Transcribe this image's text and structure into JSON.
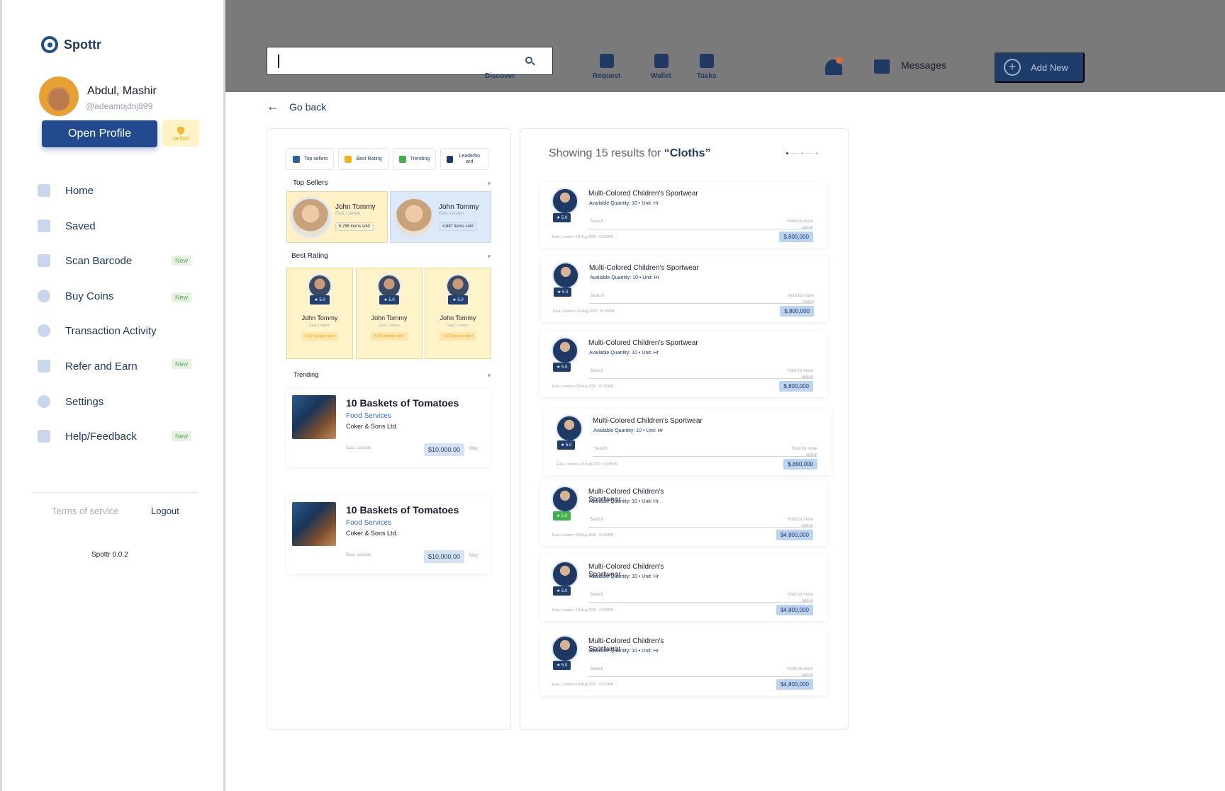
{
  "app": {
    "name": "Spottr",
    "version": "Spottr  0.0.2"
  },
  "user": {
    "name": "Abdul, Mashir",
    "handle": "@adeamojdnj899",
    "open_profile": "Open Profile",
    "verified": "Verified"
  },
  "sidebar": {
    "items": [
      {
        "label": "Home",
        "icon": "home-grid-icon",
        "badge": ""
      },
      {
        "label": "Saved",
        "icon": "bookmark-icon",
        "badge": ""
      },
      {
        "label": "Scan Barcode",
        "icon": "barcode-icon",
        "badge": "New"
      },
      {
        "label": "Buy Coins",
        "icon": "coins-icon",
        "badge": "New"
      },
      {
        "label": "Transaction Activity",
        "icon": "clock-icon",
        "badge": ""
      },
      {
        "label": "Refer and Earn",
        "icon": "users-icon",
        "badge": "New"
      },
      {
        "label": "Settings",
        "icon": "gear-icon",
        "badge": ""
      },
      {
        "label": "Help/Feedback",
        "icon": "help-icon",
        "badge": "New"
      }
    ],
    "terms": "Terms of service",
    "logout": "Logout"
  },
  "header": {
    "search_value": "",
    "nav": [
      {
        "label": "Discover",
        "icon": "compass-icon"
      },
      {
        "label": "Request",
        "icon": "request-icon"
      },
      {
        "label": "Wallet",
        "icon": "wallet-icon"
      },
      {
        "label": "Tasks",
        "icon": "clipboard-icon"
      }
    ],
    "messages": "Messages",
    "add_new": "Add New"
  },
  "go_back": "Go back",
  "filters": [
    {
      "label": "Top sellers",
      "icon": "heart-icon",
      "color": "#2f5fa8"
    },
    {
      "label": "Best Rating",
      "icon": "star-icon",
      "color": "#f2b418"
    },
    {
      "label": "Trending",
      "icon": "trend-icon",
      "color": "#3fb44a"
    },
    {
      "label": "Leaderbo ard",
      "icon": "chart-icon",
      "color": "#1f3a68"
    }
  ],
  "top_sellers": {
    "heading": "Top Sellers",
    "cards": [
      {
        "name": "John Tommy",
        "loc": "East, London",
        "sold": "5,786 items sold"
      },
      {
        "name": "John Tommy",
        "loc": "East, London",
        "sold": "4,687 items sold"
      }
    ]
  },
  "best_rating": {
    "heading": "Best Rating",
    "cards": [
      {
        "name": "John Tommy",
        "loc": "East, London",
        "rating": "★ 5.0",
        "rated": "4,567 people rated"
      },
      {
        "name": "John Tommy",
        "loc": "East, London",
        "rating": "★ 5.0",
        "rated": "4,567 people rated"
      },
      {
        "name": "John Tommy",
        "loc": "East, London",
        "rating": "★ 5.0",
        "rated": "4,567 people rated"
      }
    ]
  },
  "trending": {
    "heading": "Trending",
    "cards": [
      {
        "title": "10 Baskets of Tomatoes",
        "category": "Food Services",
        "company": "Coker & Sons Ltd.",
        "loc": "East, London",
        "price": "$10,000.00",
        "per": "/day"
      },
      {
        "title": "10 Baskets of Tomatoes",
        "category": "Food Services",
        "company": "Coker & Sons Ltd.",
        "loc": "East, London",
        "price": "$10,000.00",
        "per": "/day"
      }
    ]
  },
  "results": {
    "prefix": "Showing 15 results for ",
    "query": "“Cloths”",
    "items": [
      {
        "title": "Multi-Colored Children's Sportwear",
        "qty": "Available Quantity: 10  •  Unit: Hr",
        "rating": "★ 5.0",
        "search": "Search",
        "hold": "Hold for more option",
        "meta": "East, London    •   03 Aug 2020 : 01:05PM",
        "price": "$,800,000",
        "green": false
      },
      {
        "title": "Multi-Colored Children's Sportwear",
        "qty": "Available Quantity: 10  •  Unit: Hr",
        "rating": "★ 5.0",
        "search": "Search",
        "hold": "Hold for more option",
        "meta": "East, London    •   03 Aug 2020 : 01:05PM",
        "price": "$,800,000",
        "green": false
      },
      {
        "title": "Multi-Colored Children's Sportwear",
        "qty": "Available Quantity: 10  •  Unit: Hr",
        "rating": "★ 5.0",
        "search": "Search",
        "hold": "Hold for more option",
        "meta": "East, London    •   03 Aug 2020 : 01:05PM",
        "price": "$,800,000",
        "green": false
      },
      {
        "title": "Multi-Colored Children's Sportwear",
        "qty": "Available Quantity: 10  •  Unit: Hr",
        "rating": "★ 5.0",
        "search": "Search",
        "hold": "Hold for more option",
        "meta": "East, London    •   03 Aug 2020 : 01:05PM",
        "price": "$,800,000",
        "green": false
      },
      {
        "title": "Multi-Colored Children's Sportwear",
        "qty": "Available Quantity: 10  •  Unit: Hr",
        "rating": "★ 5.0",
        "search": "Search",
        "hold": "Hold for more option",
        "meta": "East, London    •   03 Aug 2020 : 01:05PM",
        "price": "$4,800,000",
        "green": true
      },
      {
        "title": "Multi-Colored Children's Sportwear",
        "qty": "Available Quantity: 10  •  Unit: Hr",
        "rating": "★ 5.0",
        "search": "Search",
        "hold": "Hold for more option",
        "meta": "East, London    •   03 Aug 2020 : 01:05PM",
        "price": "$4,800,000",
        "green": false
      },
      {
        "title": "Multi-Colored Children's Sportwear",
        "qty": "Available Quantity: 10  •  Unit: Hr",
        "rating": "★ 5.0",
        "search": "Search",
        "hold": "Hold for more option",
        "meta": "East, London    •   03 Aug 2020 : 01:05PM",
        "price": "$4,800,000",
        "green": false
      }
    ]
  }
}
